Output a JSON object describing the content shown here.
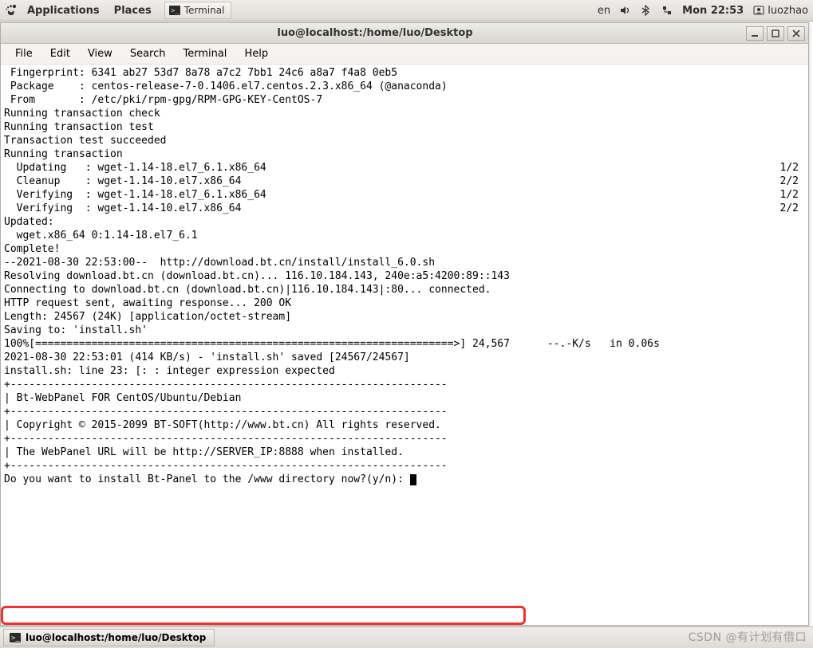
{
  "panel": {
    "applications": "Applications",
    "places": "Places",
    "task_terminal": "Terminal",
    "lang": "en",
    "clock": "Mon 22:53",
    "user": "luozhao"
  },
  "window": {
    "title": "luo@localhost:/home/luo/Desktop",
    "menus": [
      "File",
      "Edit",
      "View",
      "Search",
      "Terminal",
      "Help"
    ]
  },
  "terminal": {
    "lines": [
      " Fingerprint: 6341 ab27 53d7 8a78 a7c2 7bb1 24c6 a8a7 f4a8 0eb5",
      " Package    : centos-release-7-0.1406.el7.centos.2.3.x86_64 (@anaconda)",
      " From       : /etc/pki/rpm-gpg/RPM-GPG-KEY-CentOS-7",
      "Running transaction check",
      "Running transaction test",
      "Transaction test succeeded",
      "Running transaction",
      "  Updating   : wget-1.14-18.el7_6.1.x86_64",
      "  Cleanup    : wget-1.14-10.el7.x86_64",
      "  Verifying  : wget-1.14-18.el7_6.1.x86_64",
      "  Verifying  : wget-1.14-10.el7.x86_64",
      "",
      "Updated:",
      "  wget.x86_64 0:1.14-18.el7_6.1",
      "",
      "Complete!",
      "--2021-08-30 22:53:00--  http://download.bt.cn/install/install_6.0.sh",
      "Resolving download.bt.cn (download.bt.cn)... 116.10.184.143, 240e:a5:4200:89::143",
      "Connecting to download.bt.cn (download.bt.cn)|116.10.184.143|:80... connected.",
      "HTTP request sent, awaiting response... 200 OK",
      "Length: 24567 (24K) [application/octet-stream]",
      "Saving to: 'install.sh'",
      "",
      "100%[===================================================================>] 24,567      --.-K/s   in 0.06s",
      "",
      "2021-08-30 22:53:01 (414 KB/s) - 'install.sh' saved [24567/24567]",
      "",
      "install.sh: line 23: [: : integer expression expected",
      "",
      "+----------------------------------------------------------------------",
      "| Bt-WebPanel FOR CentOS/Ubuntu/Debian",
      "+----------------------------------------------------------------------",
      "| Copyright © 2015-2099 BT-SOFT(http://www.bt.cn) All rights reserved.",
      "+----------------------------------------------------------------------",
      "| The WebPanel URL will be http://SERVER_IP:8888 when installed.",
      "+----------------------------------------------------------------------",
      ""
    ],
    "right_values": {
      "7": "1/2",
      "8": "2/2",
      "9": "1/2",
      "10": "2/2"
    },
    "prompt": "Do you want to install Bt-Panel to the /www directory now?(y/n): "
  },
  "taskbar": {
    "task_label": "luo@localhost:/home/luo/Desktop"
  },
  "watermark": "CSDN @有计划有借口"
}
